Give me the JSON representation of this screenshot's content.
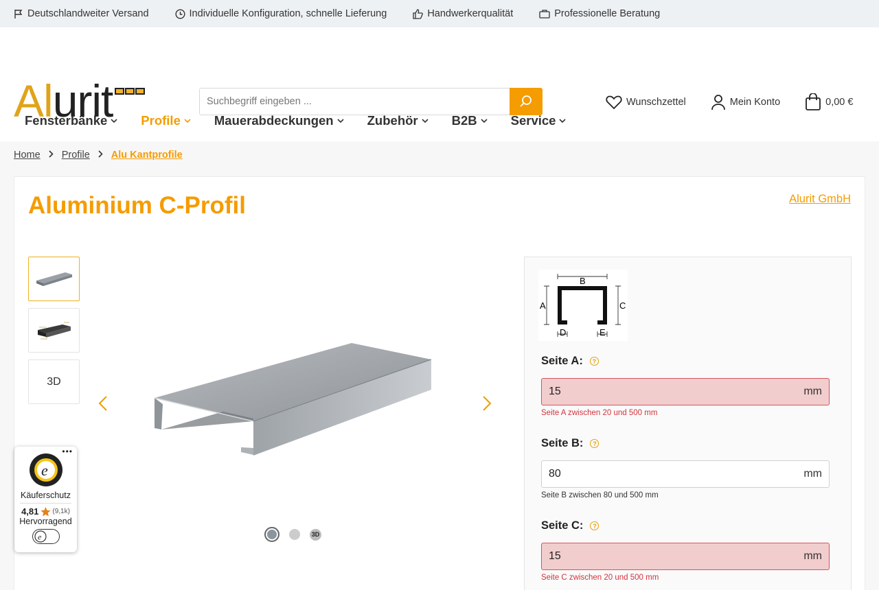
{
  "topbar": {
    "usps": [
      {
        "icon": "flag-icon",
        "label": "Deutschlandweiter Versand"
      },
      {
        "icon": "clock-icon",
        "label": "Individuelle Konfiguration, schnelle Lieferung"
      },
      {
        "icon": "thumbs-up-icon",
        "label": "Handwerkerqualität"
      },
      {
        "icon": "briefcase-icon",
        "label": "Professionelle Beratung"
      }
    ]
  },
  "header": {
    "logo_text_1": "Al",
    "logo_text_2": "urit",
    "search_placeholder": "Suchbegriff eingeben ...",
    "wishlist_label": "Wunschzettel",
    "account_label": "Mein Konto",
    "cart_total": "0,00 €"
  },
  "nav": {
    "items": [
      {
        "label": "Fensterbänke",
        "active": false
      },
      {
        "label": "Profile",
        "active": true
      },
      {
        "label": "Mauerabdeckungen",
        "active": false
      },
      {
        "label": "Zubehör",
        "active": false
      },
      {
        "label": "B2B",
        "active": false
      },
      {
        "label": "Service",
        "active": false
      }
    ]
  },
  "breadcrumb": {
    "items": [
      "Home",
      "Profile"
    ],
    "current": "Alu Kantprofile"
  },
  "product": {
    "title": "Aluminium C-Profil",
    "manufacturer": "Alurit GmbH",
    "thumb_3d_label": "3D",
    "dot_3d_label": "3D"
  },
  "config": {
    "diagram_labels": {
      "a": "A",
      "b": "B",
      "c": "C",
      "d": "D",
      "e": "E"
    },
    "help_glyph": "?",
    "fields": [
      {
        "label": "Seite A:",
        "value": "15",
        "unit": "mm",
        "hint": "Seite A zwischen 20 und 500 mm",
        "error": true
      },
      {
        "label": "Seite B:",
        "value": "80",
        "unit": "mm",
        "hint": "Seite B zwischen 80 und 500 mm",
        "error": false
      },
      {
        "label": "Seite C:",
        "value": "15",
        "unit": "mm",
        "hint": "Seite C zwischen 20 und 500 mm",
        "error": true
      }
    ]
  },
  "trust_badge": {
    "more": "•••",
    "title": "Käuferschutz",
    "rating": "4,81",
    "count": "(9,1k)",
    "verdict": "Hervorragend"
  },
  "colors": {
    "accent": "#f59c00",
    "error_bg": "#f2cdcd",
    "error_text": "#d2343d"
  }
}
